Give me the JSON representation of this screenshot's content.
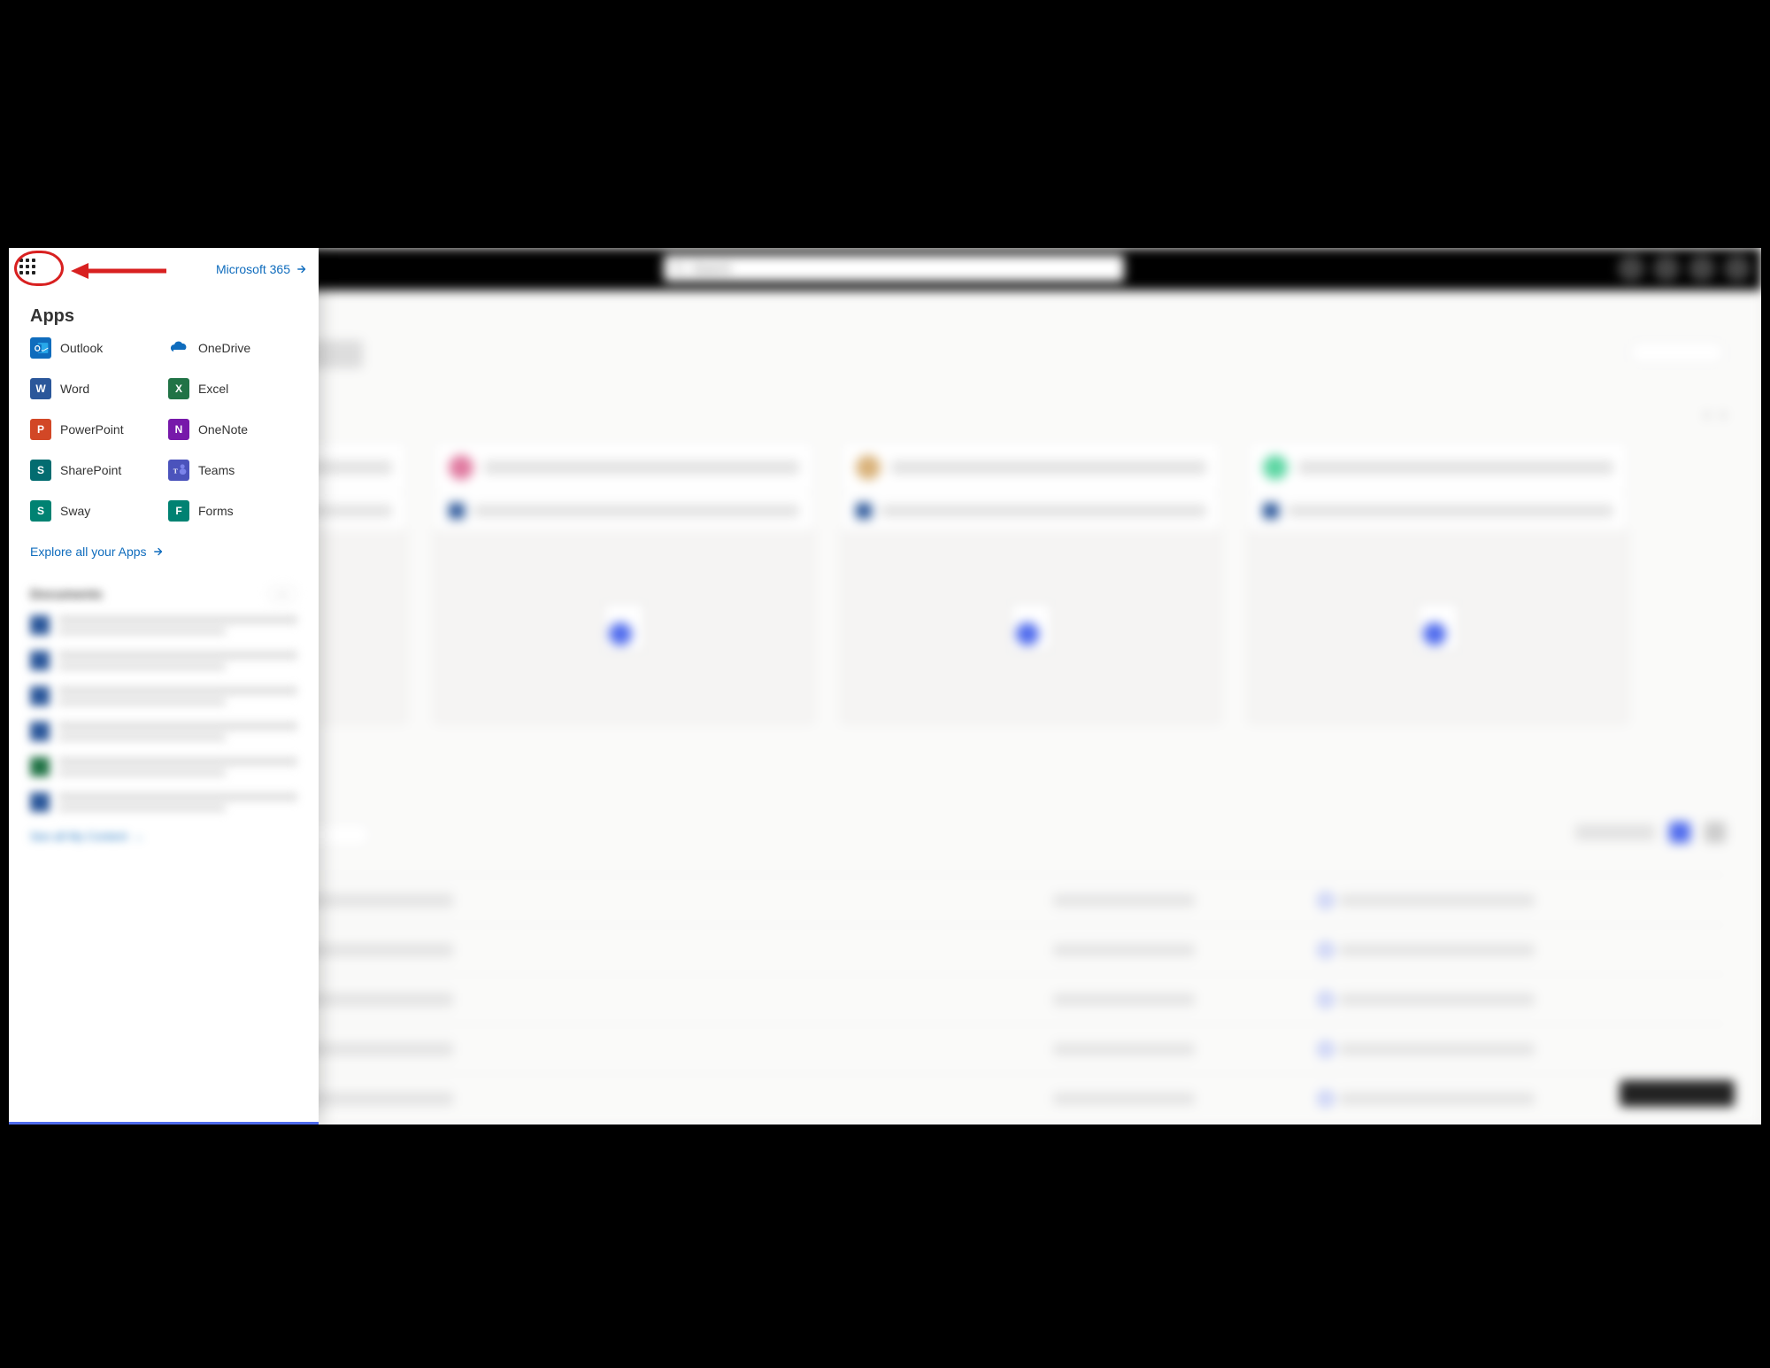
{
  "panel": {
    "m365Label": "Microsoft 365",
    "appsTitle": "Apps",
    "apps": [
      {
        "id": "outlook",
        "label": "Outlook",
        "initial": "O"
      },
      {
        "id": "onedrive",
        "label": "OneDrive",
        "initial": ""
      },
      {
        "id": "word",
        "label": "Word",
        "initial": "W"
      },
      {
        "id": "excel",
        "label": "Excel",
        "initial": "X"
      },
      {
        "id": "powerpoint",
        "label": "PowerPoint",
        "initial": "P"
      },
      {
        "id": "onenote",
        "label": "OneNote",
        "initial": "N"
      },
      {
        "id": "sharepoint",
        "label": "SharePoint",
        "initial": "S"
      },
      {
        "id": "teams",
        "label": "Teams",
        "initial": "T"
      },
      {
        "id": "sway",
        "label": "Sway",
        "initial": "S"
      },
      {
        "id": "forms",
        "label": "Forms",
        "initial": "F"
      }
    ],
    "exploreLabel": "Explore all your Apps",
    "documentsTitle": "Documents",
    "seeAllLabel": "See all My Content"
  },
  "search": {
    "placeholder": "Search"
  }
}
